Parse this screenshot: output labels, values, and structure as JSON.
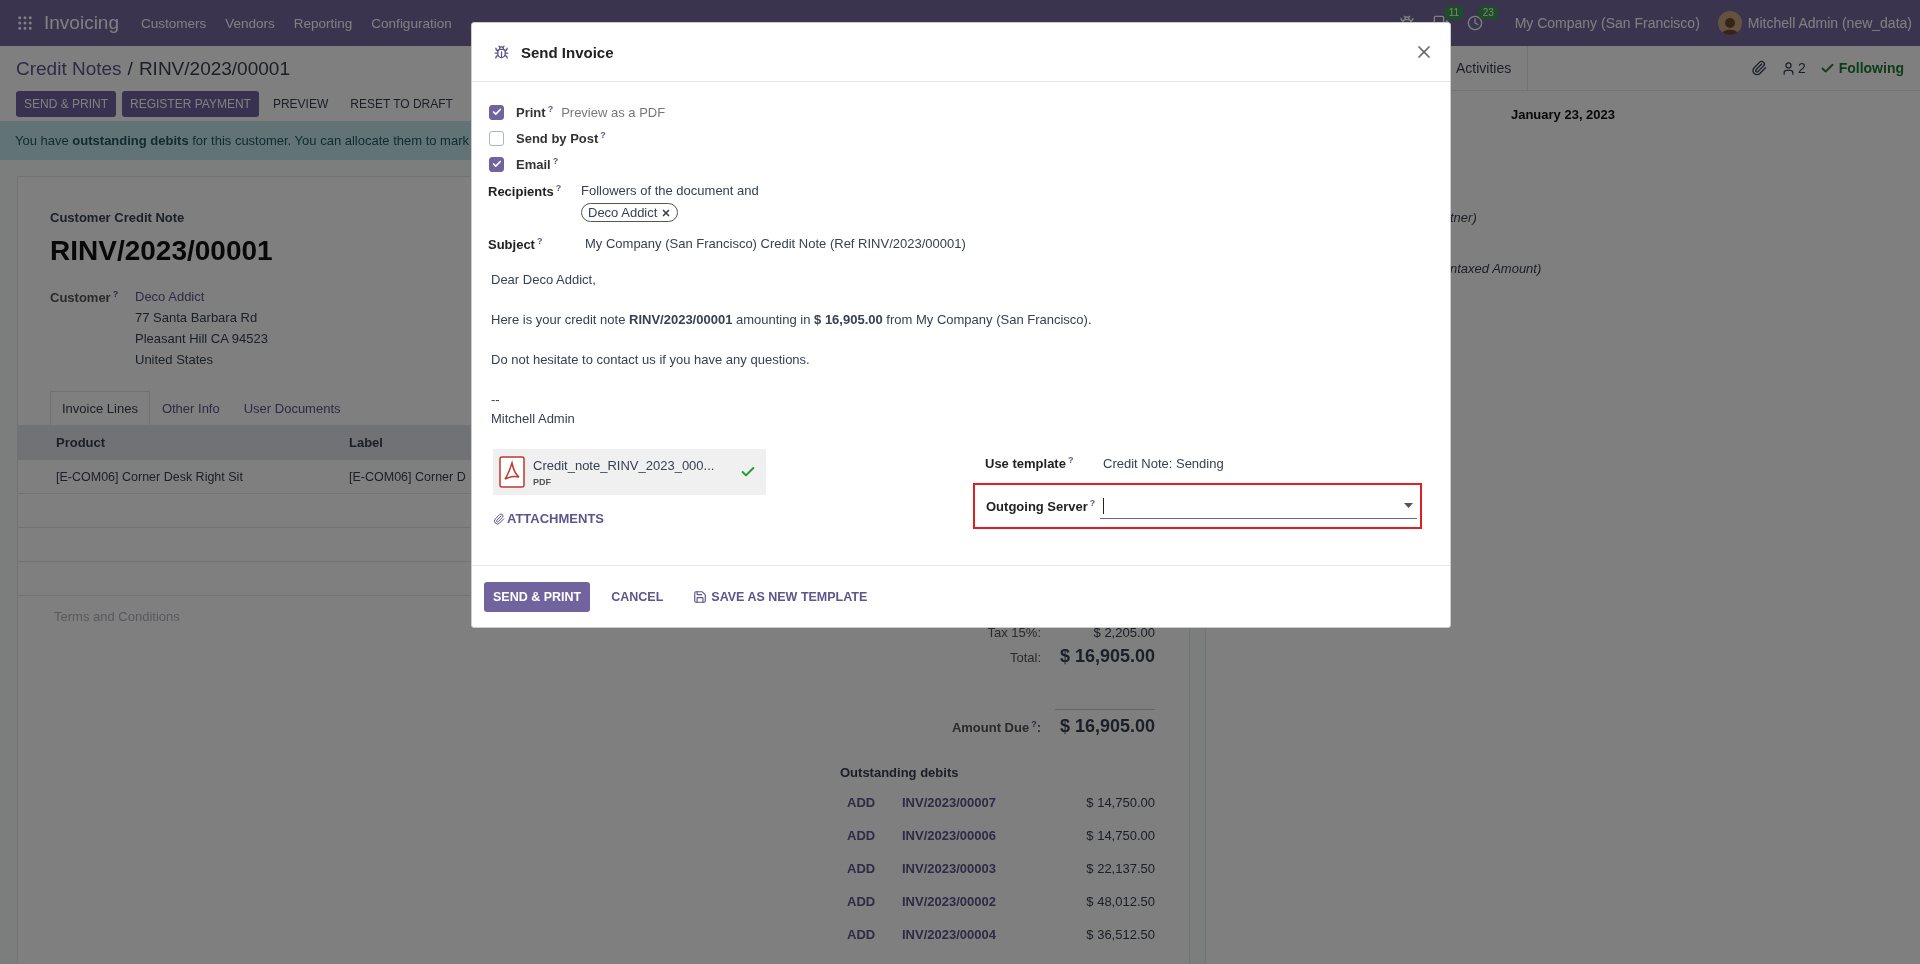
{
  "navbar": {
    "app": "Invoicing",
    "menu": [
      "Customers",
      "Vendors",
      "Reporting",
      "Configuration"
    ],
    "indicators": [
      {
        "kind": "bug"
      },
      {
        "kind": "chat",
        "count": "11"
      },
      {
        "kind": "activity",
        "count": "23"
      }
    ],
    "company": "My Company (San Francisco)",
    "user": "Mitchell Admin (new_data)"
  },
  "breadcrumb": {
    "parent": "Credit Notes",
    "separator": "/",
    "current": "RINV/2023/00001"
  },
  "actions": [
    {
      "label": "SEND & PRINT",
      "primary": true
    },
    {
      "label": "REGISTER PAYMENT",
      "primary": true
    },
    {
      "label": "PREVIEW",
      "primary": false
    },
    {
      "label": "RESET TO DRAFT",
      "primary": false
    }
  ],
  "alert": "You have **outstanding debits** for this customer. You can allocate them to mark",
  "sheet": {
    "type_label": "Customer Credit Note",
    "number": "RINV/2023/00001",
    "customer": {
      "label": "Customer$^{?}$",
      "name": "Deco Addict",
      "address": [
        "77 Santa Barbara Rd",
        "Pleasant Hill CA 94523",
        "United States"
      ]
    },
    "tabs": [
      {
        "label": "Invoice Lines",
        "selected": true
      },
      {
        "label": "Other Info",
        "selected": false
      },
      {
        "label": "User Documents",
        "selected": false
      }
    ],
    "columns": [
      "Product",
      "Label"
    ],
    "rows": [
      [
        "[E-COM06] Corner Desk Right Sit",
        "[E-COM06] Corner D"
      ]
    ],
    "terms_placeholder": "Terms and Conditions"
  },
  "totals": {
    "tax": {
      "label": "Tax 15%:",
      "value": "$ 2,205.00"
    },
    "total": {
      "label": "Total:",
      "value": "$ 16,905.00"
    },
    "amount_due": {
      "label": "Amount Due$^{?}$:",
      "value": "$ 16,905.00"
    },
    "outstanding": {
      "title": "Outstanding debits",
      "rows": [
        {
          "action": "ADD",
          "ref": "INV/2023/00007",
          "amount": "$ 14,750.00"
        },
        {
          "action": "ADD",
          "ref": "INV/2023/00006",
          "amount": "$ 14,750.00"
        },
        {
          "action": "ADD",
          "ref": "INV/2023/00003",
          "amount": "$ 22,137.50"
        },
        {
          "action": "ADD",
          "ref": "INV/2023/00002",
          "amount": "$ 48,012.50"
        },
        {
          "action": "ADD",
          "ref": "INV/2023/00004",
          "amount": "$ 36,512.50"
        }
      ]
    }
  },
  "chatter": {
    "tab": "Activities",
    "followers": "2",
    "follow": {
      "label": "Following",
      "on": true
    },
    "date": "January 23, 2023",
    "fragments": [
      "tner)",
      "ntaxed Amount)"
    ]
  },
  "dialog": {
    "title": "Send Invoice",
    "options": [
      {
        "label": "Print$^{?}$",
        "checked": true,
        "hint": "Preview as a PDF"
      },
      {
        "label": "Send by Post$^{?}$",
        "checked": false
      },
      {
        "label": "Email$^{?}$",
        "checked": true
      }
    ],
    "recipients": {
      "label": "Recipients$^{?}$",
      "text": "Followers of the document and",
      "tags": [
        "Deco Addict"
      ]
    },
    "subject": {
      "label": "Subject$^{?}$",
      "value": "My Company (San Francisco) Credit Note (Ref RINV/2023/00001)"
    },
    "body": [
      [
        "Dear Deco Addict,"
      ],
      [
        "Here is your credit note **RINV/2023/00001** amounting in **$ 16,905.00** from My Company (San Francisco)."
      ],
      [
        "Do not hesitate to contact us if you have any questions."
      ],
      [
        "--",
        "Mitchell Admin"
      ]
    ],
    "attachment": {
      "name": "Credit_note_RINV_2023_000...",
      "type": "PDF",
      "uploaded": true
    },
    "attachments_link": "ATTACHMENTS",
    "template": {
      "label": "Use template$^{?}$",
      "value": "Credit Note: Sending"
    },
    "outgoing_server": {
      "label": "Outgoing Server$^{?}$",
      "focused": true,
      "highlighted": true
    },
    "buttons": [
      {
        "label": "SEND & PRINT",
        "kind": "primary"
      },
      {
        "label": "CANCEL",
        "kind": "link"
      },
      {
        "label": "SAVE AS NEW TEMPLATE",
        "kind": "save"
      }
    ]
  }
}
